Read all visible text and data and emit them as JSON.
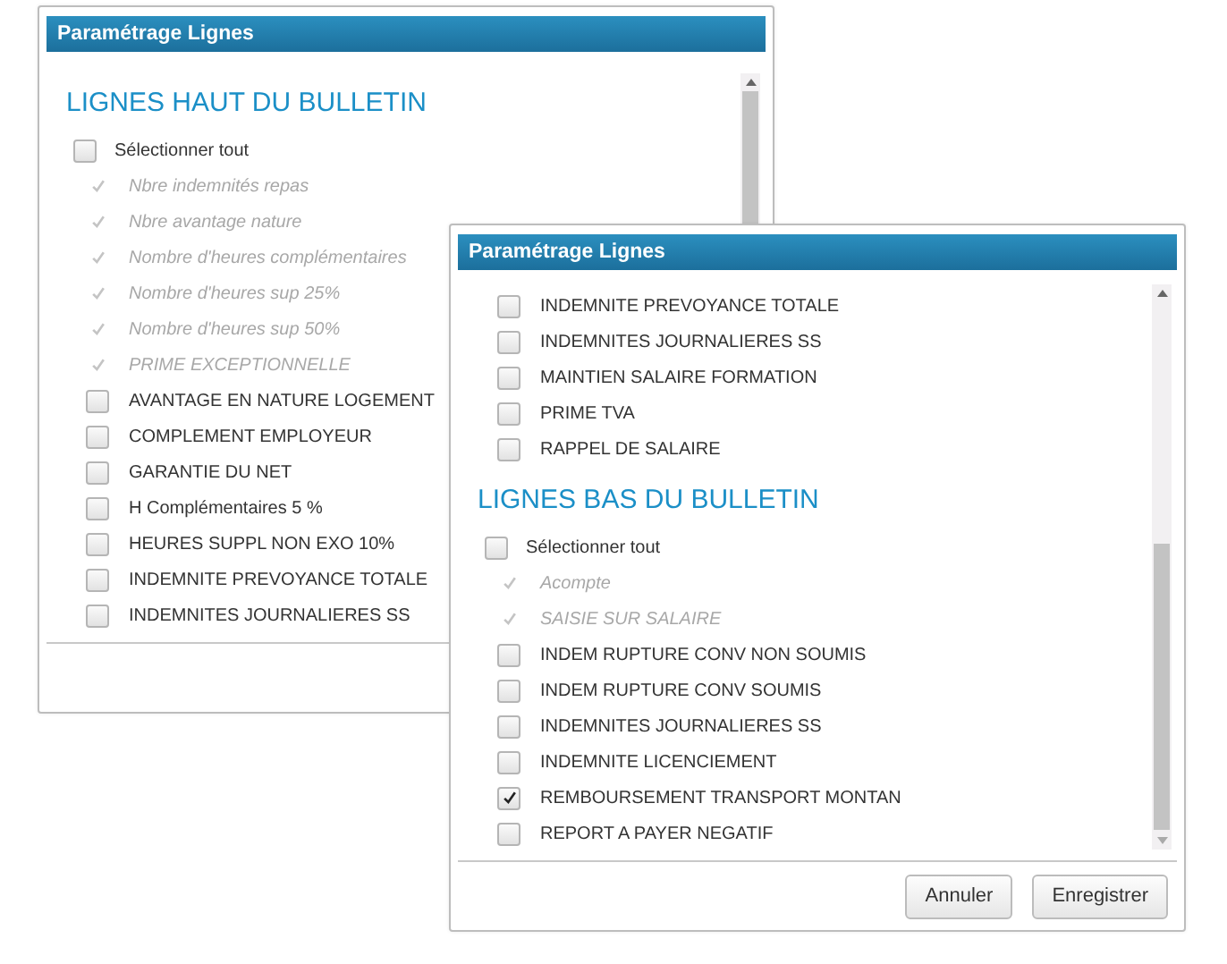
{
  "dialogs": [
    {
      "title": "Paramétrage Lignes",
      "sections": [
        {
          "heading": "LIGNES HAUT DU BULLETIN",
          "select_all": {
            "label": "Sélectionner tout",
            "checked": false
          },
          "items": [
            {
              "label": "Nbre indemnités repas",
              "checked": true,
              "disabled": true
            },
            {
              "label": "Nbre avantage nature",
              "checked": true,
              "disabled": true
            },
            {
              "label": "Nombre d'heures complémentaires",
              "checked": true,
              "disabled": true
            },
            {
              "label": "Nombre d'heures sup 25%",
              "checked": true,
              "disabled": true
            },
            {
              "label": "Nombre d'heures sup 50%",
              "checked": true,
              "disabled": true
            },
            {
              "label": "PRIME EXCEPTIONNELLE",
              "checked": true,
              "disabled": true
            },
            {
              "label": "AVANTAGE EN NATURE LOGEMENT",
              "checked": false,
              "disabled": false
            },
            {
              "label": "COMPLEMENT EMPLOYEUR",
              "checked": false,
              "disabled": false
            },
            {
              "label": "GARANTIE DU NET",
              "checked": false,
              "disabled": false
            },
            {
              "label": "H Complémentaires 5 %",
              "checked": false,
              "disabled": false
            },
            {
              "label": "HEURES SUPPL NON EXO 10%",
              "checked": false,
              "disabled": false
            },
            {
              "label": "INDEMNITE PREVOYANCE TOTALE",
              "checked": false,
              "disabled": false
            },
            {
              "label": "INDEMNITES JOURNALIERES SS",
              "checked": false,
              "disabled": false
            }
          ]
        }
      ]
    },
    {
      "title": "Paramétrage Lignes",
      "sections": [
        {
          "items": [
            {
              "label": "INDEMNITE PREVOYANCE TOTALE",
              "checked": false,
              "disabled": false
            },
            {
              "label": "INDEMNITES JOURNALIERES SS",
              "checked": false,
              "disabled": false
            },
            {
              "label": "MAINTIEN SALAIRE FORMATION",
              "checked": false,
              "disabled": false
            },
            {
              "label": "PRIME TVA",
              "checked": false,
              "disabled": false
            },
            {
              "label": "RAPPEL DE SALAIRE",
              "checked": false,
              "disabled": false
            }
          ]
        },
        {
          "heading": "LIGNES BAS DU BULLETIN",
          "select_all": {
            "label": "Sélectionner tout",
            "checked": false
          },
          "items": [
            {
              "label": "Acompte",
              "checked": true,
              "disabled": true
            },
            {
              "label": "SAISIE SUR SALAIRE",
              "checked": true,
              "disabled": true
            },
            {
              "label": "INDEM RUPTURE CONV NON SOUMIS",
              "checked": false,
              "disabled": false
            },
            {
              "label": "INDEM RUPTURE CONV SOUMIS",
              "checked": false,
              "disabled": false
            },
            {
              "label": "INDEMNITES JOURNALIERES SS",
              "checked": false,
              "disabled": false
            },
            {
              "label": "INDEMNITE LICENCIEMENT",
              "checked": false,
              "disabled": false
            },
            {
              "label": "REMBOURSEMENT TRANSPORT MONTAN",
              "checked": true,
              "disabled": false
            },
            {
              "label": "REPORT A PAYER NEGATIF",
              "checked": false,
              "disabled": false
            }
          ]
        }
      ],
      "buttons": [
        "Annuler",
        "Enregistrer"
      ]
    }
  ]
}
